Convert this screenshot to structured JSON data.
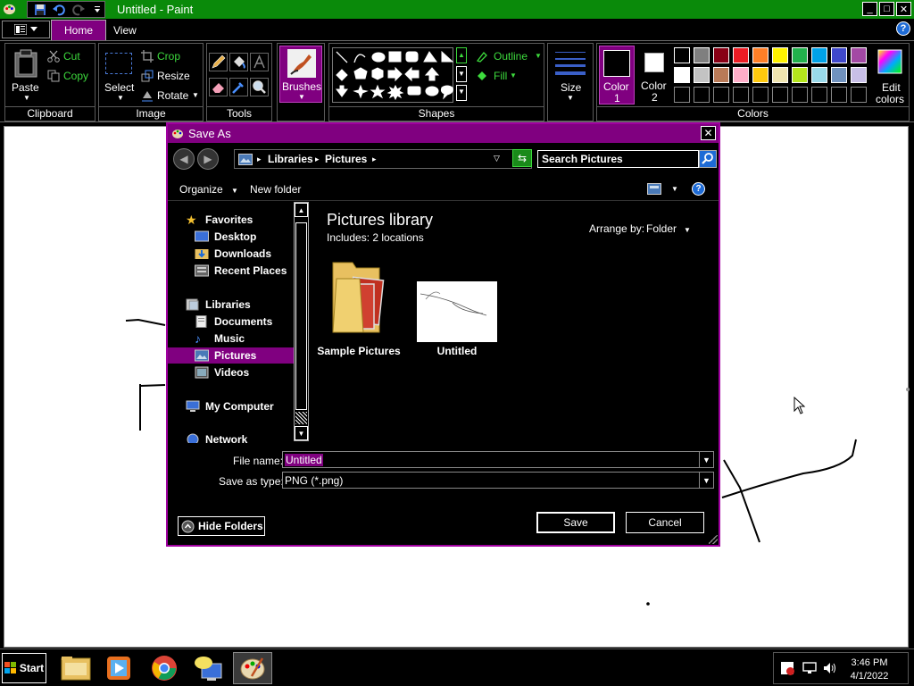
{
  "window": {
    "title": "Untitled - Paint",
    "controls": {
      "minimize": "_",
      "maximize": "□",
      "close": "✕"
    }
  },
  "ribbon": {
    "tabs": [
      {
        "label": "Home",
        "active": true
      },
      {
        "label": "View",
        "active": false
      }
    ],
    "help": "?",
    "clipboard": {
      "group": "Clipboard",
      "paste": "Paste",
      "cut": "Cut",
      "copy": "Copy"
    },
    "image": {
      "group": "Image",
      "select": "Select",
      "crop": "Crop",
      "resize": "Resize",
      "rotate": "Rotate"
    },
    "tools": {
      "group": "Tools"
    },
    "brushes": {
      "label": "Brushes"
    },
    "shapes": {
      "group": "Shapes",
      "outline": "Outline",
      "fill": "Fill"
    },
    "size": {
      "label": "Size"
    },
    "colors": {
      "group": "Colors",
      "color1": "Color 1",
      "color1_line1": "Color",
      "color1_line2": "1",
      "color2_line1": "Color",
      "color2_line2": "2",
      "color1_value": "#000000",
      "color2_value": "#ffffff",
      "edit_line1": "Edit",
      "edit_line2": "colors",
      "row1": [
        "#000000",
        "#7f7f7f",
        "#880015",
        "#ed1c24",
        "#ff7f27",
        "#fff200",
        "#22b14c",
        "#00a2e8",
        "#3f48cc",
        "#a349a4"
      ],
      "row2": [
        "#ffffff",
        "#c3c3c3",
        "#b97a57",
        "#ffaec9",
        "#ffc90e",
        "#efe4b0",
        "#b5e61d",
        "#99d9ea",
        "#7092be",
        "#c8bfe7"
      ]
    }
  },
  "dialog": {
    "title": "Save As",
    "close": "✕",
    "address": {
      "seg1": "Libraries",
      "seg2": "Pictures"
    },
    "search_placeholder": "Search Pictures",
    "organize": "Organize",
    "new_folder": "New folder",
    "nav": {
      "favorites": "Favorites",
      "desktop": "Desktop",
      "downloads": "Downloads",
      "recent": "Recent Places",
      "libraries": "Libraries",
      "documents": "Documents",
      "music": "Music",
      "pictures": "Pictures",
      "videos": "Videos",
      "computer": "My Computer",
      "network": "Network"
    },
    "library": {
      "title": "Pictures library",
      "includes": "Includes:  2 locations",
      "arrange_label": "Arrange by:",
      "arrange_value": "Folder"
    },
    "items": [
      {
        "name": "Sample Pictures",
        "kind": "folder"
      },
      {
        "name": "Untitled",
        "kind": "image"
      }
    ],
    "file_name_label": "File name:",
    "file_name_value": "Untitled",
    "save_type_label": "Save as type:",
    "save_type_value": "PNG (*.png)",
    "hide_folders": "Hide Folders",
    "save": "Save",
    "cancel": "Cancel"
  },
  "taskbar": {
    "start": "Start",
    "time": "3:46 PM",
    "date": "4/1/2022"
  }
}
